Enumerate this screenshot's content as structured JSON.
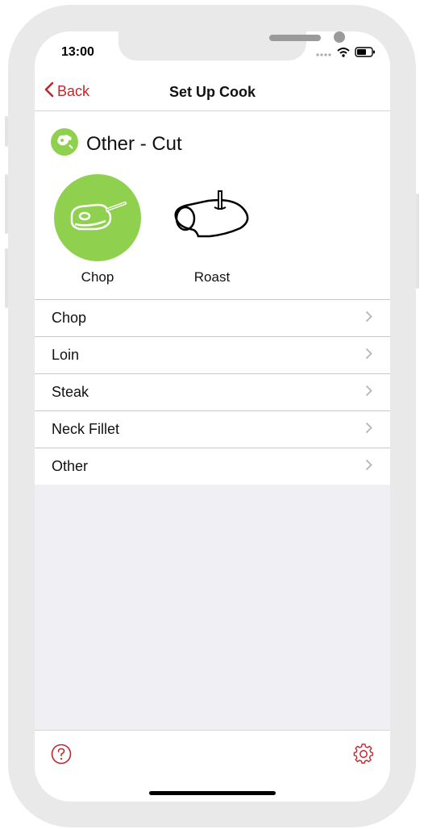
{
  "status_bar": {
    "time": "13:00",
    "signal_icon": "signal-dots-icon",
    "wifi_icon": "wifi-icon",
    "battery_icon": "battery-icon"
  },
  "navbar": {
    "back_label": "Back",
    "title": "Set Up Cook"
  },
  "section": {
    "title": "Other - Cut",
    "icon": "meat-icon",
    "icon_color": "#8fd14f"
  },
  "cut_options": [
    {
      "label": "Chop",
      "icon": "chop-icon",
      "selected": true
    },
    {
      "label": "Roast",
      "icon": "roast-icon",
      "selected": false
    }
  ],
  "list_items": [
    {
      "label": "Chop"
    },
    {
      "label": "Loin"
    },
    {
      "label": "Steak"
    },
    {
      "label": "Neck Fillet"
    },
    {
      "label": "Other"
    }
  ],
  "toolbar": {
    "help_icon": "help-icon",
    "settings_icon": "gear-icon"
  },
  "colors": {
    "accent": "#c0262d",
    "selected_green": "#8fd14f"
  }
}
